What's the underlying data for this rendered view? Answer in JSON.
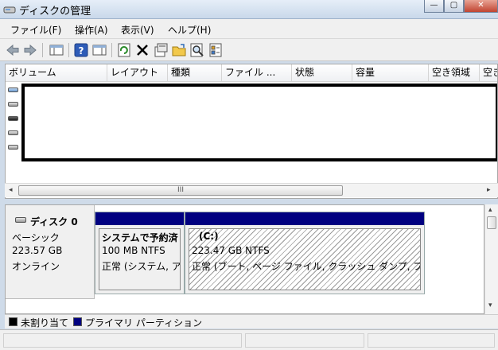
{
  "window": {
    "title": "ディスクの管理",
    "controls": {
      "minimize": "—",
      "maximize": "▢",
      "close": "✕"
    }
  },
  "menu": [
    "ファイル(F)",
    "操作(A)",
    "表示(V)",
    "ヘルプ(H)"
  ],
  "toolbar": {
    "buttons": [
      "back-arrow",
      "forward-arrow",
      "console-tree",
      "help",
      "action-pane",
      "refresh",
      "delete",
      "properties",
      "open",
      "search",
      "export"
    ]
  },
  "volume_list": {
    "columns": [
      "ボリューム",
      "レイアウト",
      "種類",
      "ファイル ...",
      "状態",
      "容量",
      "空き領域",
      "空き"
    ]
  },
  "scrollbar": {
    "left_arrow": "◂",
    "right_arrow": "▸",
    "grip": "III",
    "up_arrow": "▴",
    "down_arrow": "▾"
  },
  "disk": {
    "name": "ディスク 0",
    "type": "ベーシック",
    "size": "223.57 GB",
    "status": "オンライン",
    "partitions": [
      {
        "name": "システムで予約済",
        "detail": "100 MB NTFS",
        "status": "正常 (システム, ア"
      },
      {
        "name": "(C:)",
        "detail": "223.47 GB NTFS",
        "status": "正常 (ブート, ページ ファイル, クラッシュ ダンプ, プ"
      }
    ]
  },
  "legend": [
    {
      "label": "未割り当て",
      "color": "#000000"
    },
    {
      "label": "プライマリ パーティション",
      "color": "#000080"
    }
  ]
}
